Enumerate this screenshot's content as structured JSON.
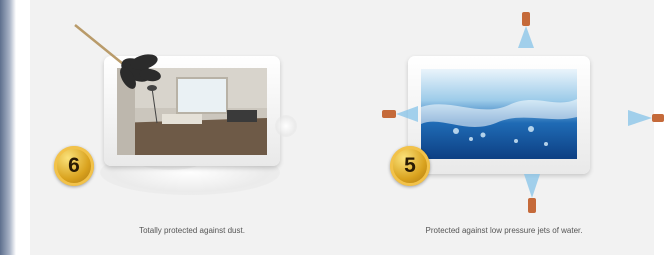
{
  "left_card": {
    "badge": "6",
    "caption": "Totally protected against dust.",
    "icon": "feather-duster-icon"
  },
  "right_card": {
    "badge": "5",
    "caption": "Protected against low pressure jets of water.",
    "icon": "water-jet-icon"
  },
  "colors": {
    "panel": "#f2f2f2",
    "gold": "#d9a21e",
    "water": "#1b66b3",
    "copper": "#c56a3a"
  }
}
